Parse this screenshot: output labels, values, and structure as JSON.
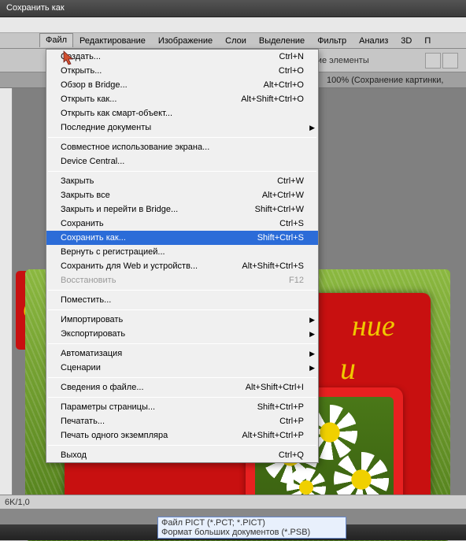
{
  "window": {
    "title": "Сохранить как"
  },
  "menubar": {
    "items": [
      "Файл",
      "Редактирование",
      "Изображение",
      "Слои",
      "Выделение",
      "Фильтр",
      "Анализ",
      "3D",
      "П"
    ]
  },
  "options": {
    "label_fragment": "ующие элементы"
  },
  "doc_tab": {
    "text": "100% (Сохранение картинки,"
  },
  "red_card": {
    "line1": "ние",
    "line2": "и",
    "edge": "С"
  },
  "file_menu": {
    "groups": [
      [
        {
          "label": "Создать...",
          "shortcut": "Ctrl+N",
          "name": "menu-new"
        },
        {
          "label": "Открыть...",
          "shortcut": "Ctrl+O",
          "name": "menu-open"
        },
        {
          "label": "Обзор в Bridge...",
          "shortcut": "Alt+Ctrl+O",
          "name": "menu-browse-bridge"
        },
        {
          "label": "Открыть как...",
          "shortcut": "Alt+Shift+Ctrl+O",
          "name": "menu-open-as"
        },
        {
          "label": "Открыть как смарт-объект...",
          "shortcut": "",
          "name": "menu-open-smart"
        },
        {
          "label": "Последние документы",
          "shortcut": "",
          "name": "menu-recent",
          "sub": true
        }
      ],
      [
        {
          "label": "Совместное использование экрана...",
          "shortcut": "",
          "name": "menu-share-screen"
        },
        {
          "label": "Device Central...",
          "shortcut": "",
          "name": "menu-device-central"
        }
      ],
      [
        {
          "label": "Закрыть",
          "shortcut": "Ctrl+W",
          "name": "menu-close"
        },
        {
          "label": "Закрыть все",
          "shortcut": "Alt+Ctrl+W",
          "name": "menu-close-all"
        },
        {
          "label": "Закрыть и перейти в Bridge...",
          "shortcut": "Shift+Ctrl+W",
          "name": "menu-close-bridge"
        },
        {
          "label": "Сохранить",
          "shortcut": "Ctrl+S",
          "name": "menu-save"
        },
        {
          "label": "Сохранить как...",
          "shortcut": "Shift+Ctrl+S",
          "name": "menu-save-as",
          "hl": true
        },
        {
          "label": "Вернуть с регистрацией...",
          "shortcut": "",
          "name": "menu-checkin"
        },
        {
          "label": "Сохранить для Web и устройств...",
          "shortcut": "Alt+Shift+Ctrl+S",
          "name": "menu-save-web"
        },
        {
          "label": "Восстановить",
          "shortcut": "F12",
          "name": "menu-revert",
          "disabled": true
        }
      ],
      [
        {
          "label": "Поместить...",
          "shortcut": "",
          "name": "menu-place"
        }
      ],
      [
        {
          "label": "Импортировать",
          "shortcut": "",
          "name": "menu-import",
          "sub": true
        },
        {
          "label": "Экспортировать",
          "shortcut": "",
          "name": "menu-export",
          "sub": true
        }
      ],
      [
        {
          "label": "Автоматизация",
          "shortcut": "",
          "name": "menu-automate",
          "sub": true
        },
        {
          "label": "Сценарии",
          "shortcut": "",
          "name": "menu-scripts",
          "sub": true
        }
      ],
      [
        {
          "label": "Сведения о файле...",
          "shortcut": "Alt+Shift+Ctrl+I",
          "name": "menu-fileinfo"
        }
      ],
      [
        {
          "label": "Параметры страницы...",
          "shortcut": "Shift+Ctrl+P",
          "name": "menu-page-setup"
        },
        {
          "label": "Печатать...",
          "shortcut": "Ctrl+P",
          "name": "menu-print"
        },
        {
          "label": "Печать одного экземпляра",
          "shortcut": "Alt+Shift+Ctrl+P",
          "name": "menu-print-one"
        }
      ],
      [
        {
          "label": "Выход",
          "shortcut": "Ctrl+Q",
          "name": "menu-exit"
        }
      ]
    ]
  },
  "status": {
    "zoom": "6K/1,0"
  },
  "format_hint": {
    "line1": "Файл PICT (*.PCT; *.PICT)",
    "line2": "Формат больших документов (*.PSB)"
  }
}
